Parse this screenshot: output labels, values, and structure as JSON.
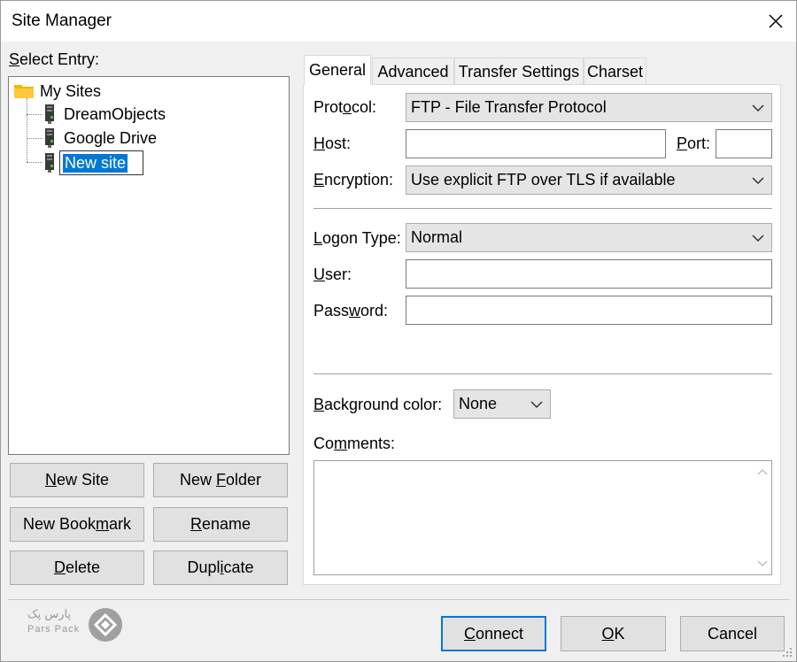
{
  "window": {
    "title": "Site Manager"
  },
  "left": {
    "select_entry_label": "Select Entry:",
    "tree": {
      "root": "My Sites",
      "items": [
        "DreamObjects",
        "Google Drive",
        "New site"
      ]
    },
    "buttons": {
      "new_site": "New Site",
      "new_folder": "New Folder",
      "new_bookmark": "New Bookmark",
      "rename": "Rename",
      "delete": "Delete",
      "duplicate": "Duplicate"
    }
  },
  "tabs": [
    "General",
    "Advanced",
    "Transfer Settings",
    "Charset"
  ],
  "general": {
    "protocol_label": "Protocol:",
    "protocol_value": "FTP - File Transfer Protocol",
    "host_label": "Host:",
    "host_value": "",
    "port_label": "Port:",
    "port_value": "",
    "encryption_label": "Encryption:",
    "encryption_value": "Use explicit FTP over TLS if available",
    "logon_type_label": "Logon Type:",
    "logon_type_value": "Normal",
    "user_label": "User:",
    "user_value": "",
    "password_label": "Password:",
    "password_value": "",
    "background_color_label": "Background color:",
    "background_color_value": "None",
    "comments_label": "Comments:",
    "comments_value": ""
  },
  "footer": {
    "connect": "Connect",
    "ok": "OK",
    "cancel": "Cancel",
    "logo_text_fa": "پارس پک",
    "logo_text_en": "Pars Pack"
  },
  "colors": {
    "selection": "#0078d7",
    "folder": "#f5b400"
  }
}
